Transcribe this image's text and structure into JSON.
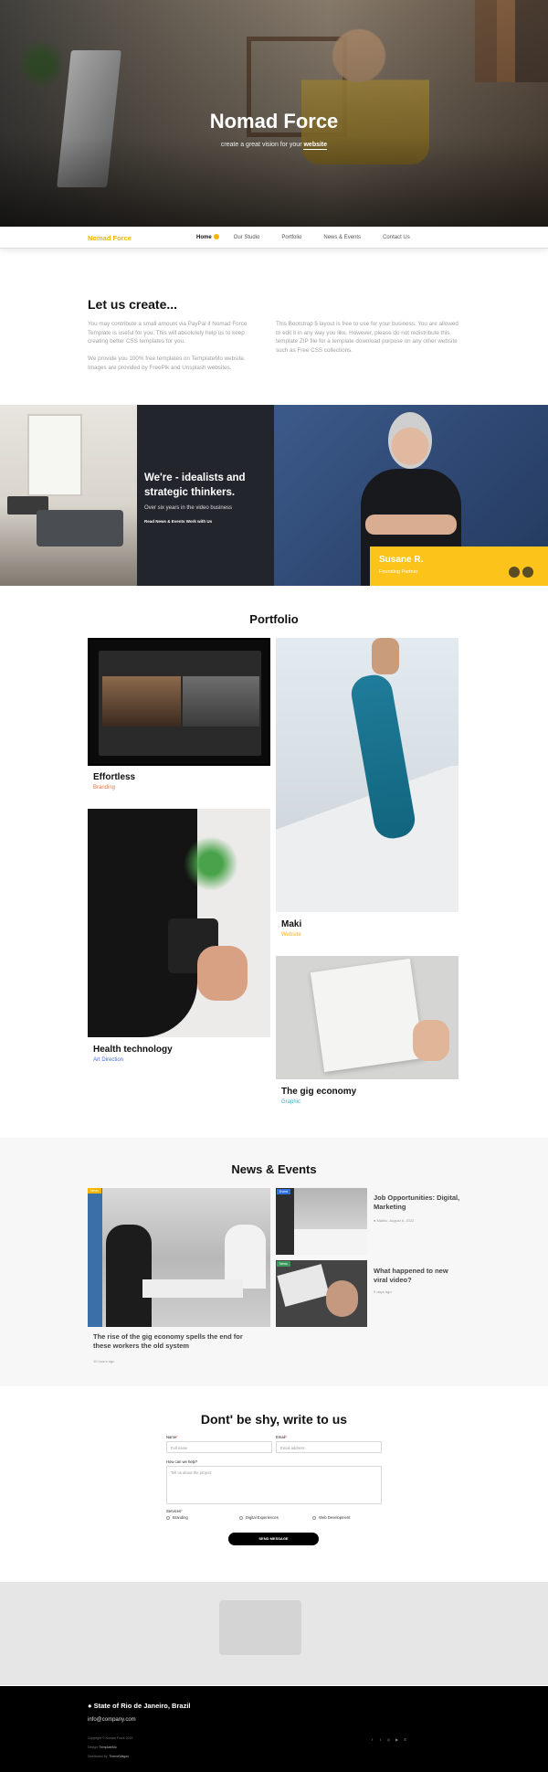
{
  "hero": {
    "title": "Nomad Force",
    "subtitle_prefix": "create a great vision for your",
    "subtitle_link": "website"
  },
  "nav": {
    "brand": "Nomad Force",
    "links": [
      "Home",
      "Our Studio",
      "Portfolio",
      "News & Events",
      "Contact Us"
    ],
    "active": "Home",
    "accent": "#f4b400"
  },
  "about": {
    "title": "Let us create...",
    "left_p1": "You may contribute a small amount via PayPal if Nomad Force Template is useful for you. This will absolutely help us to keep creating better CSS templates for you.",
    "left_p2": "We provide you 100% free templates on TemplateMo website. Images are provided by FreePik and Unsplash websites.",
    "right_p1": "This Bootstrap 5 layout is free to use for your business. You are allowed to edit it in any way you like. However, please do not redistribute this template ZIP file for a template download purpose on any other website such as Free CSS collections."
  },
  "banner": {
    "heading": "We're - idealists and strategic thinkers.",
    "sub": "Over six years in the video business",
    "link": "Read News & Events Work with Us",
    "person_name": "Susane R.",
    "person_role": "Founding Partner",
    "accent": "#fcc31a"
  },
  "portfolio": {
    "title": "Portfolio",
    "items": [
      {
        "title": "Effortless",
        "category": "Branding",
        "color": "#e07a3c"
      },
      {
        "title": "Maki",
        "category": "Website",
        "color": "#f4b400"
      },
      {
        "title": "Health technology",
        "category": "Art Direction",
        "color": "#4b6fd1"
      },
      {
        "title": "The gig economy",
        "category": "Graphic",
        "color": "#3ab0c9"
      }
    ]
  },
  "news": {
    "title": "News & Events",
    "main": {
      "badge": "News",
      "badge_color": "#f4b400",
      "title": "The rise of the gig economy spells the end for these workers the old system",
      "meta": "10 hours ago"
    },
    "side": [
      {
        "badge": "Event",
        "badge_color": "#2f6fe0",
        "title": "Job Opportunities: Digital, Marketing",
        "meta": "Malibu, August 6, 2022"
      },
      {
        "badge": "News",
        "badge_color": "#3a9a5a",
        "title": "What happened to new viral video?",
        "meta": "5 days ago"
      }
    ]
  },
  "contact": {
    "title": "Dont' be shy, write to us",
    "name_label": "Name",
    "name_placeholder": "Full name",
    "email_label": "Email",
    "email_placeholder": "Email address",
    "message_label": "How can we help?",
    "message_placeholder": "Tell us about the project",
    "services_label": "Services",
    "services": [
      "Branding",
      "Digital Experiences",
      "Web Development"
    ],
    "submit": "SEND MESSAGE"
  },
  "footer": {
    "address": "State of Rio de Janeiro, Brazil",
    "email": "info@company.com",
    "copyright": "Copyright © Nomad Force 2022",
    "design_label": "Design:",
    "design_value": "TemplateMo",
    "distributed_label": "Distributed by:",
    "distributed_value": "ThemeWagon",
    "social": [
      "facebook-icon",
      "twitter-icon",
      "instagram-icon",
      "youtube-icon",
      "whatsapp-icon"
    ]
  }
}
